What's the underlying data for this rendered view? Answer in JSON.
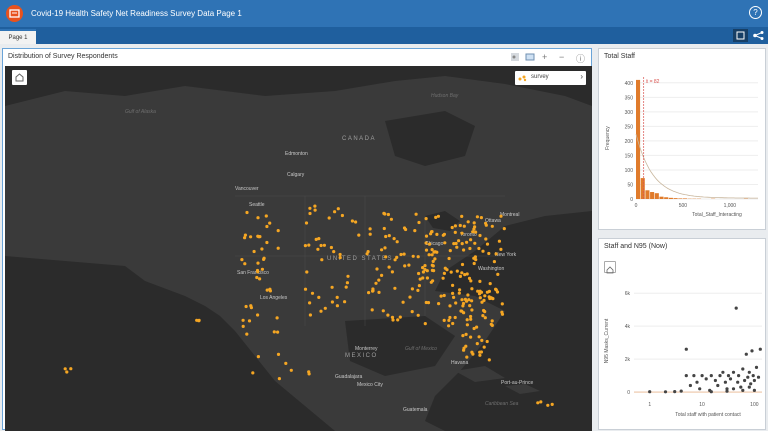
{
  "app": {
    "title": "Covid-19 Health Safety Net Readiness Survey Data Page 1",
    "help_icon": "help-icon"
  },
  "tabs": [
    {
      "label": "Page 1"
    }
  ],
  "map_card": {
    "title": "Distribution of Survey Respondents",
    "legend_label": "survey",
    "tool_minus": "−",
    "tool_plus": "+",
    "tool_info": "ⓘ"
  },
  "map_labels": {
    "canada": "CANADA",
    "united_states": "UNITED STATES",
    "mexico": "MEXICO",
    "edmonton": "Edmonton",
    "calgary": "Calgary",
    "vancouver": "Vancouver",
    "seattle": "Seattle",
    "san_francisco": "San Francisco",
    "los_angeles": "Los Angeles",
    "ottawa": "Ottawa",
    "montreal": "Montreal",
    "toronto": "Toronto",
    "chicago": "Chicago",
    "washington": "Washington",
    "new_york": "New York",
    "monterrey": "Monterrey",
    "guadalajara": "Guadalajara",
    "mexico_city": "Mexico City",
    "havana": "Havana",
    "guatemala": "Guatemala",
    "port_au_prince": "Port-au-Prince",
    "hudson_bay": "Hudson Bay",
    "gulf_of_alaska": "Gulf of Alaska",
    "gulf_of_mexico": "Gulf of Mexico",
    "caribbean_sea": "Caribbean Sea"
  },
  "chart_data": [
    {
      "type": "bar",
      "title": "Total Staff",
      "xlabel": "Total_Staff_Interacting",
      "ylabel": "Frequency",
      "y_ticks": [
        "0",
        "50",
        "100",
        "150",
        "200",
        "250",
        "300",
        "350",
        "400"
      ],
      "x_ticks": [
        "0",
        "500",
        "1,000"
      ],
      "ylim": [
        0,
        420
      ],
      "xlim": [
        0,
        1300
      ],
      "annotation": "x̄ = 82",
      "bin_width": 50,
      "values": [
        410,
        72,
        30,
        24,
        20,
        8,
        6,
        4,
        3,
        2,
        2,
        1,
        1,
        1,
        0,
        0,
        1,
        0,
        0,
        0,
        0,
        0,
        0,
        1,
        0,
        0
      ]
    },
    {
      "type": "scatter",
      "title": "Staff and N95 (Now)",
      "xlabel": "Total staff with patient contact",
      "ylabel": "N95 Masks_Current",
      "y_ticks": [
        "0",
        "2k",
        "4k",
        "6k"
      ],
      "x_ticks": [
        "1",
        "10",
        "100"
      ],
      "x_scale": "log",
      "xlim": [
        0.5,
        140
      ],
      "ylim": [
        -300,
        6500
      ],
      "points": [
        [
          1,
          20
        ],
        [
          2,
          15
        ],
        [
          3,
          30
        ],
        [
          4,
          60
        ],
        [
          5,
          1000
        ],
        [
          5,
          2600
        ],
        [
          6,
          400
        ],
        [
          7,
          1000
        ],
        [
          8,
          600
        ],
        [
          9,
          200
        ],
        [
          10,
          1000
        ],
        [
          12,
          800
        ],
        [
          14,
          100
        ],
        [
          15,
          1000
        ],
        [
          18,
          700
        ],
        [
          20,
          400
        ],
        [
          22,
          1000
        ],
        [
          25,
          1200
        ],
        [
          28,
          600
        ],
        [
          30,
          200
        ],
        [
          32,
          1000
        ],
        [
          35,
          800
        ],
        [
          40,
          1200
        ],
        [
          45,
          5100
        ],
        [
          48,
          600
        ],
        [
          50,
          1000
        ],
        [
          55,
          300
        ],
        [
          60,
          1400
        ],
        [
          65,
          700
        ],
        [
          70,
          2300
        ],
        [
          75,
          900
        ],
        [
          80,
          1200
        ],
        [
          85,
          500
        ],
        [
          90,
          2500
        ],
        [
          95,
          1000
        ],
        [
          100,
          700
        ],
        [
          110,
          1500
        ],
        [
          120,
          900
        ],
        [
          130,
          2600
        ],
        [
          60,
          100
        ],
        [
          30,
          50
        ],
        [
          15,
          20
        ],
        [
          100,
          100
        ],
        [
          80,
          300
        ],
        [
          40,
          200
        ]
      ]
    }
  ],
  "icons": {
    "logo": "survey-app-logo",
    "home": "home-icon",
    "legend": "legend-icon",
    "table": "table-icon",
    "help": "help-icon"
  }
}
